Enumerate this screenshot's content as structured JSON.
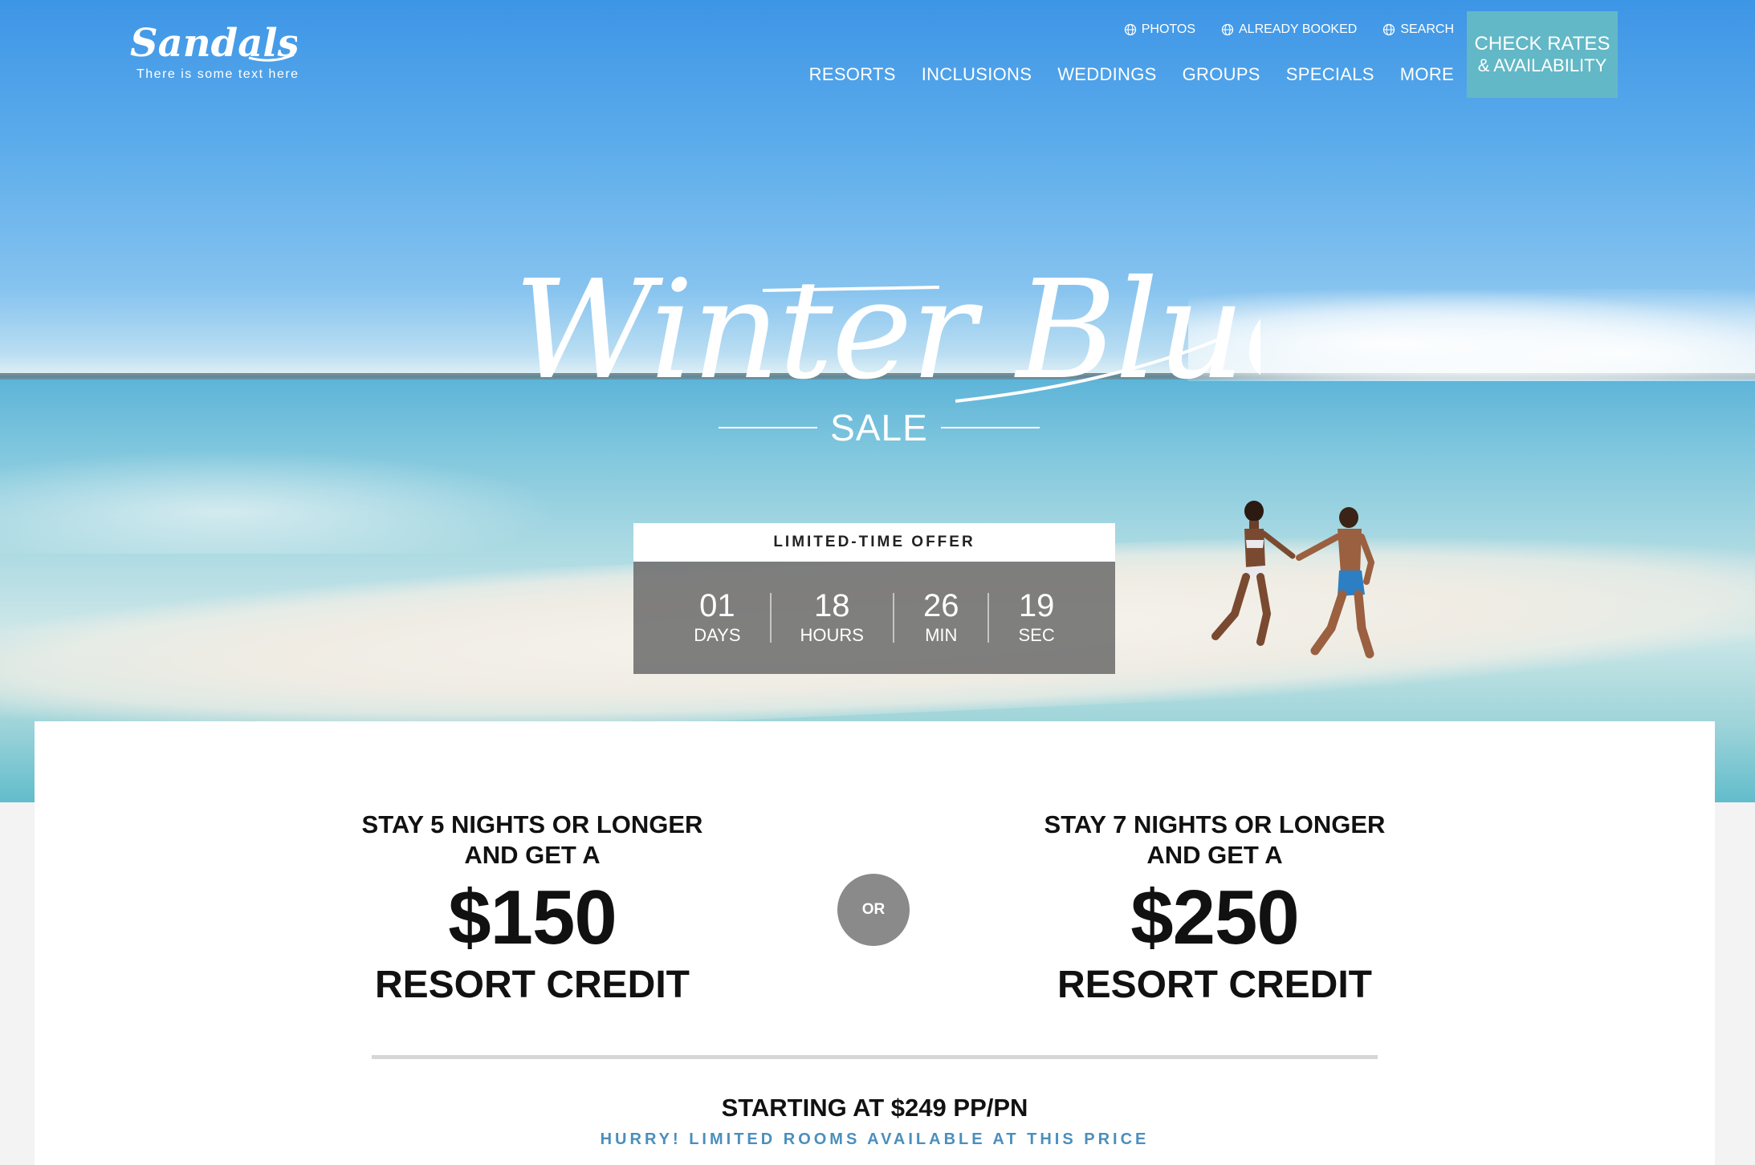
{
  "header": {
    "logo_text": "Sandals",
    "tagline": "There is some text here",
    "utility_links": [
      {
        "label": "PHOTOS",
        "icon": "globe-icon"
      },
      {
        "label": "ALREADY BOOKED",
        "icon": "globe-icon"
      },
      {
        "label": "SEARCH",
        "icon": "globe-icon"
      }
    ],
    "nav": [
      "RESORTS",
      "INCLUSIONS",
      "WEDDINGS",
      "GROUPS",
      "SPECIALS",
      "MORE"
    ],
    "cta": {
      "line1": "CHECK RATES",
      "line2": "& AVAILABILITY"
    }
  },
  "hero": {
    "script_title": "Winter Blues",
    "subtitle": "SALE"
  },
  "countdown": {
    "header": "LIMITED-TIME  OFFER",
    "units": [
      {
        "value": "01",
        "label": "DAYS"
      },
      {
        "value": "18",
        "label": "HOURS"
      },
      {
        "value": "26",
        "label": "MIN"
      },
      {
        "value": "19",
        "label": "SEC"
      }
    ]
  },
  "offers": {
    "left": {
      "line1": "STAY 5 NIGHTS OR LONGER",
      "line2": "AND GET A",
      "amount": "$150",
      "credit": "RESORT CREDIT"
    },
    "or": "OR",
    "right": {
      "line1": "STAY 7 NIGHTS OR LONGER",
      "line2": "AND GET A",
      "amount": "$250",
      "credit": "RESORT CREDIT"
    }
  },
  "pricing": {
    "starting": "STARTING AT $249 PP/PN",
    "hurry": "HURRY! LIMITED ROOMS AVAILABLE AT THIS PRICE"
  },
  "colors": {
    "cta_bg": "#62b8c6",
    "hurry_text": "#4a8fbd",
    "or_badge": "#8a8a8a"
  }
}
